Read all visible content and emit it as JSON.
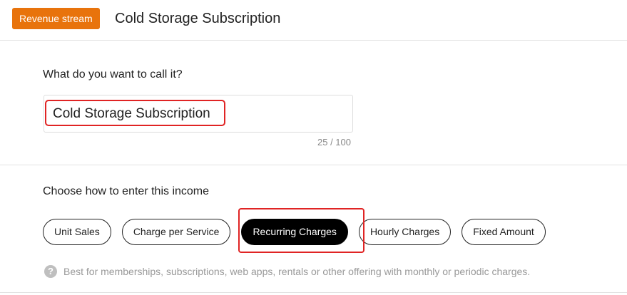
{
  "header": {
    "badge_label": "Revenue stream",
    "title": "Cold Storage Subscription"
  },
  "name_section": {
    "label": "What do you want to call it?",
    "input_value": "Cold Storage Subscription",
    "char_count": "25 / 100"
  },
  "income_section": {
    "label": "Choose how to enter this income",
    "options": [
      {
        "label": "Unit Sales",
        "selected": false
      },
      {
        "label": "Charge per Service",
        "selected": false
      },
      {
        "label": "Recurring Charges",
        "selected": true
      },
      {
        "label": "Hourly Charges",
        "selected": false
      },
      {
        "label": "Fixed Amount",
        "selected": false
      }
    ],
    "help_icon": "question-circle-icon",
    "help_glyph": "?",
    "help_text": "Best for memberships, subscriptions, web apps, rentals or other offering with monthly or periodic charges."
  },
  "colors": {
    "accent": "#e8730c",
    "selected_option": "#000000",
    "annotation": "#e02424"
  }
}
